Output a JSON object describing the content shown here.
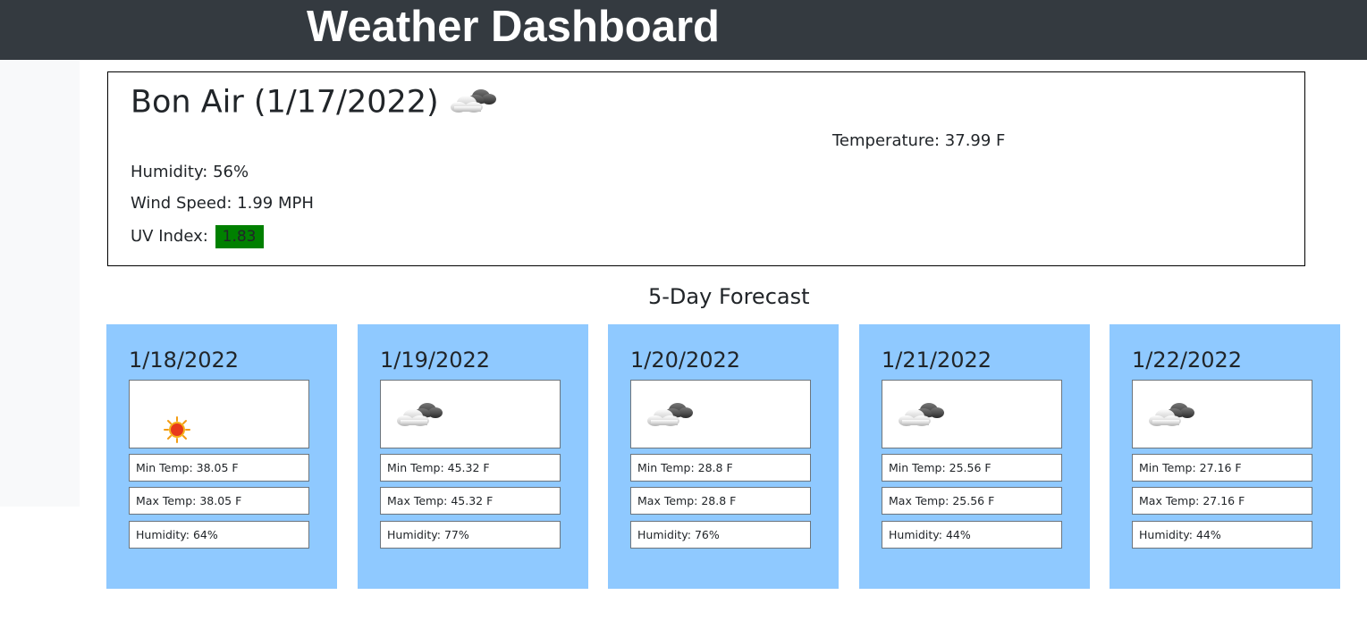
{
  "header": {
    "title": "Weather Dashboard"
  },
  "current": {
    "title": "Bon Air (1/17/2022)",
    "icon": "cloud-icon",
    "temperature": "Temperature: 37.99 F",
    "humidity": "Humidity: 56%",
    "wind": "Wind Speed: 1.99 MPH",
    "uv_label": "UV Index:",
    "uv_value": "1.83",
    "uv_color": "#008000"
  },
  "forecast": {
    "title": "5-Day Forecast",
    "card_color": "#8fc9ff",
    "days": [
      {
        "date": "1/18/2022",
        "icon": "sun-icon",
        "min": "Min Temp: 38.05 F",
        "max": "Max Temp: 38.05 F",
        "humidity": "Humidity: 64%"
      },
      {
        "date": "1/19/2022",
        "icon": "cloud-icon",
        "min": "Min Temp: 45.32 F",
        "max": "Max Temp: 45.32 F",
        "humidity": "Humidity: 77%"
      },
      {
        "date": "1/20/2022",
        "icon": "cloud-icon",
        "min": "Min Temp: 28.8 F",
        "max": "Max Temp: 28.8 F",
        "humidity": "Humidity: 76%"
      },
      {
        "date": "1/21/2022",
        "icon": "cloud-icon",
        "min": "Min Temp: 25.56 F",
        "max": "Max Temp: 25.56 F",
        "humidity": "Humidity: 44%"
      },
      {
        "date": "1/22/2022",
        "icon": "cloud-icon",
        "min": "Min Temp: 27.16 F",
        "max": "Max Temp: 27.16 F",
        "humidity": "Humidity: 44%"
      }
    ]
  }
}
